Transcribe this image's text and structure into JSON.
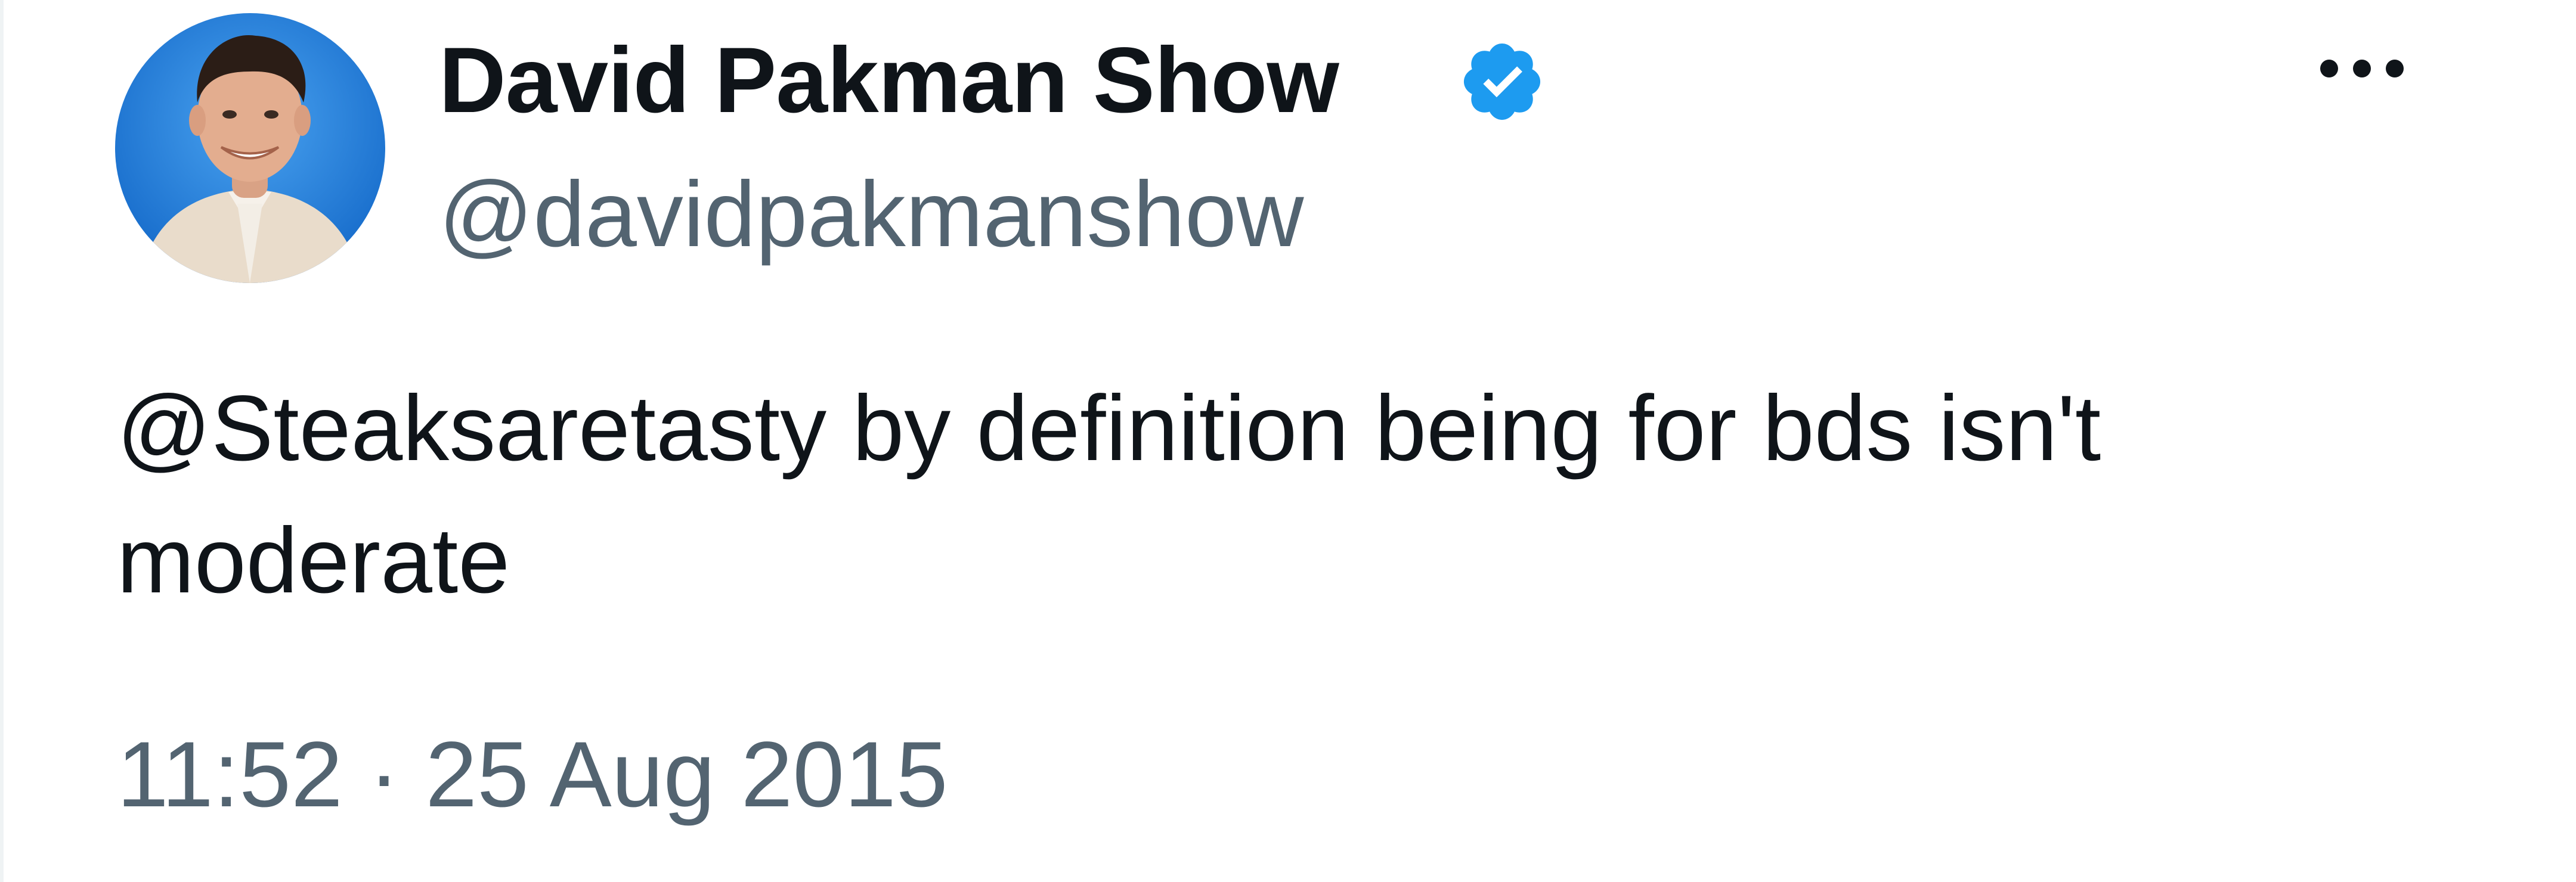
{
  "tweet": {
    "author": {
      "display_name": "David Pakman Show",
      "handle": "@davidpakmanshow",
      "verified": true,
      "avatar_icon": "profile-photo",
      "verified_icon": "verified-badge-icon"
    },
    "text_mention": "@Steaksaretasty",
    "text_body": " by definition being for bds isn't moderate",
    "timestamp": "11:52 · 25 Aug 2015",
    "more_icon": "more-options-icon"
  },
  "colors": {
    "text_primary": "#0f1419",
    "text_secondary": "#536471",
    "verified_blue": "#1d9bf0",
    "avatar_bg": "#1e78d6"
  }
}
